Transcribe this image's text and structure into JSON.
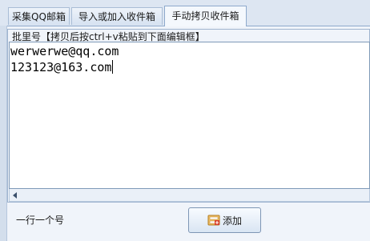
{
  "tabs": [
    {
      "label": "采集QQ邮箱",
      "active": false
    },
    {
      "label": "导入或加入收件箱",
      "active": false
    },
    {
      "label": "手动拷贝收件箱",
      "active": true
    }
  ],
  "group": {
    "caption": "批里号【拷贝后按ctrl+v粘贴到下面编辑框】"
  },
  "editor": {
    "lines": [
      "werwerwe@qq.com",
      "123123@163.com"
    ]
  },
  "hint_text": "一行一个号",
  "add_button": {
    "label": "添加",
    "icon": "add-contact-icon"
  },
  "colors": {
    "accent": "#8ea9cc",
    "panel": "#f0f4fa"
  }
}
